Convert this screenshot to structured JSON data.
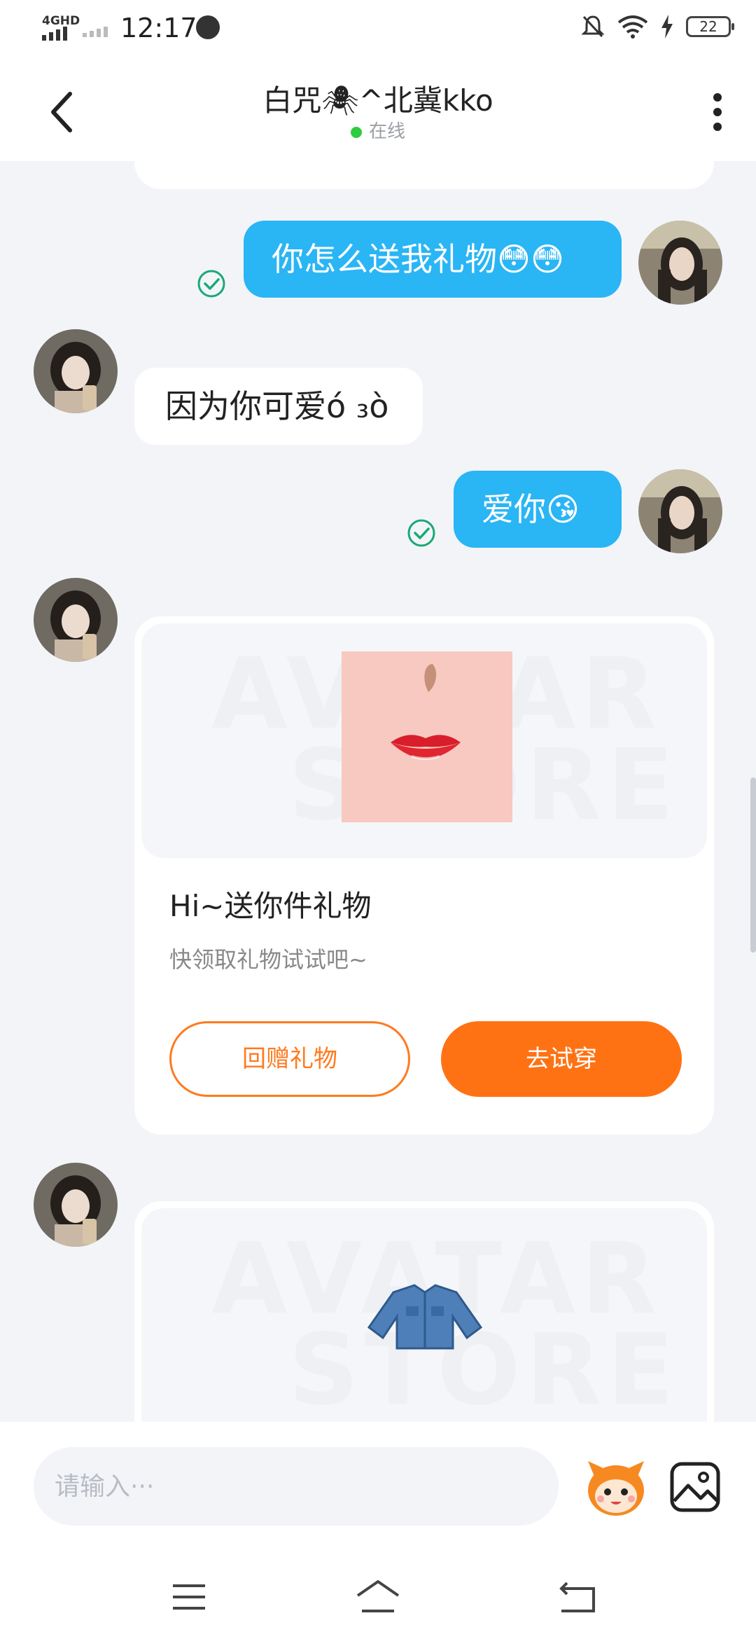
{
  "status_bar": {
    "network": "4GHD",
    "time": "12:17",
    "battery": "22"
  },
  "header": {
    "title": "白咒🕷^北冀kko",
    "status": "在线"
  },
  "messages": [
    {
      "type": "text",
      "direction": "out",
      "text": "你怎么送我礼物😳😳",
      "read": true
    },
    {
      "type": "text",
      "direction": "in",
      "text": "因为你可爱ό ₃ò"
    },
    {
      "type": "text",
      "direction": "out",
      "text": "爱你😘",
      "read": true
    },
    {
      "type": "gift",
      "direction": "in",
      "watermark_top": "AVATAR",
      "watermark_bottom": "STORE",
      "title": "Hi~送你件礼物",
      "subtitle": "快领取礼物试试吧~",
      "left_button": "回赠礼物",
      "right_button": "去试穿"
    },
    {
      "type": "gift",
      "direction": "in",
      "watermark_top": "AVATAR",
      "watermark_bottom": "STORE"
    }
  ],
  "input": {
    "placeholder": "请输入···"
  },
  "icons": {
    "back": "back-arrow-icon",
    "more": "more-vertical-icon",
    "read": "check-circle-icon",
    "mascot": "mascot-emoji-icon",
    "image": "image-icon",
    "nav_menu": "menu-icon",
    "nav_home": "home-icon",
    "nav_back": "return-icon"
  },
  "colors": {
    "bubble_out": "#2ab5f5",
    "accent_orange": "#ff7214",
    "online_green": "#2ecc40",
    "read_check": "#19a974"
  }
}
